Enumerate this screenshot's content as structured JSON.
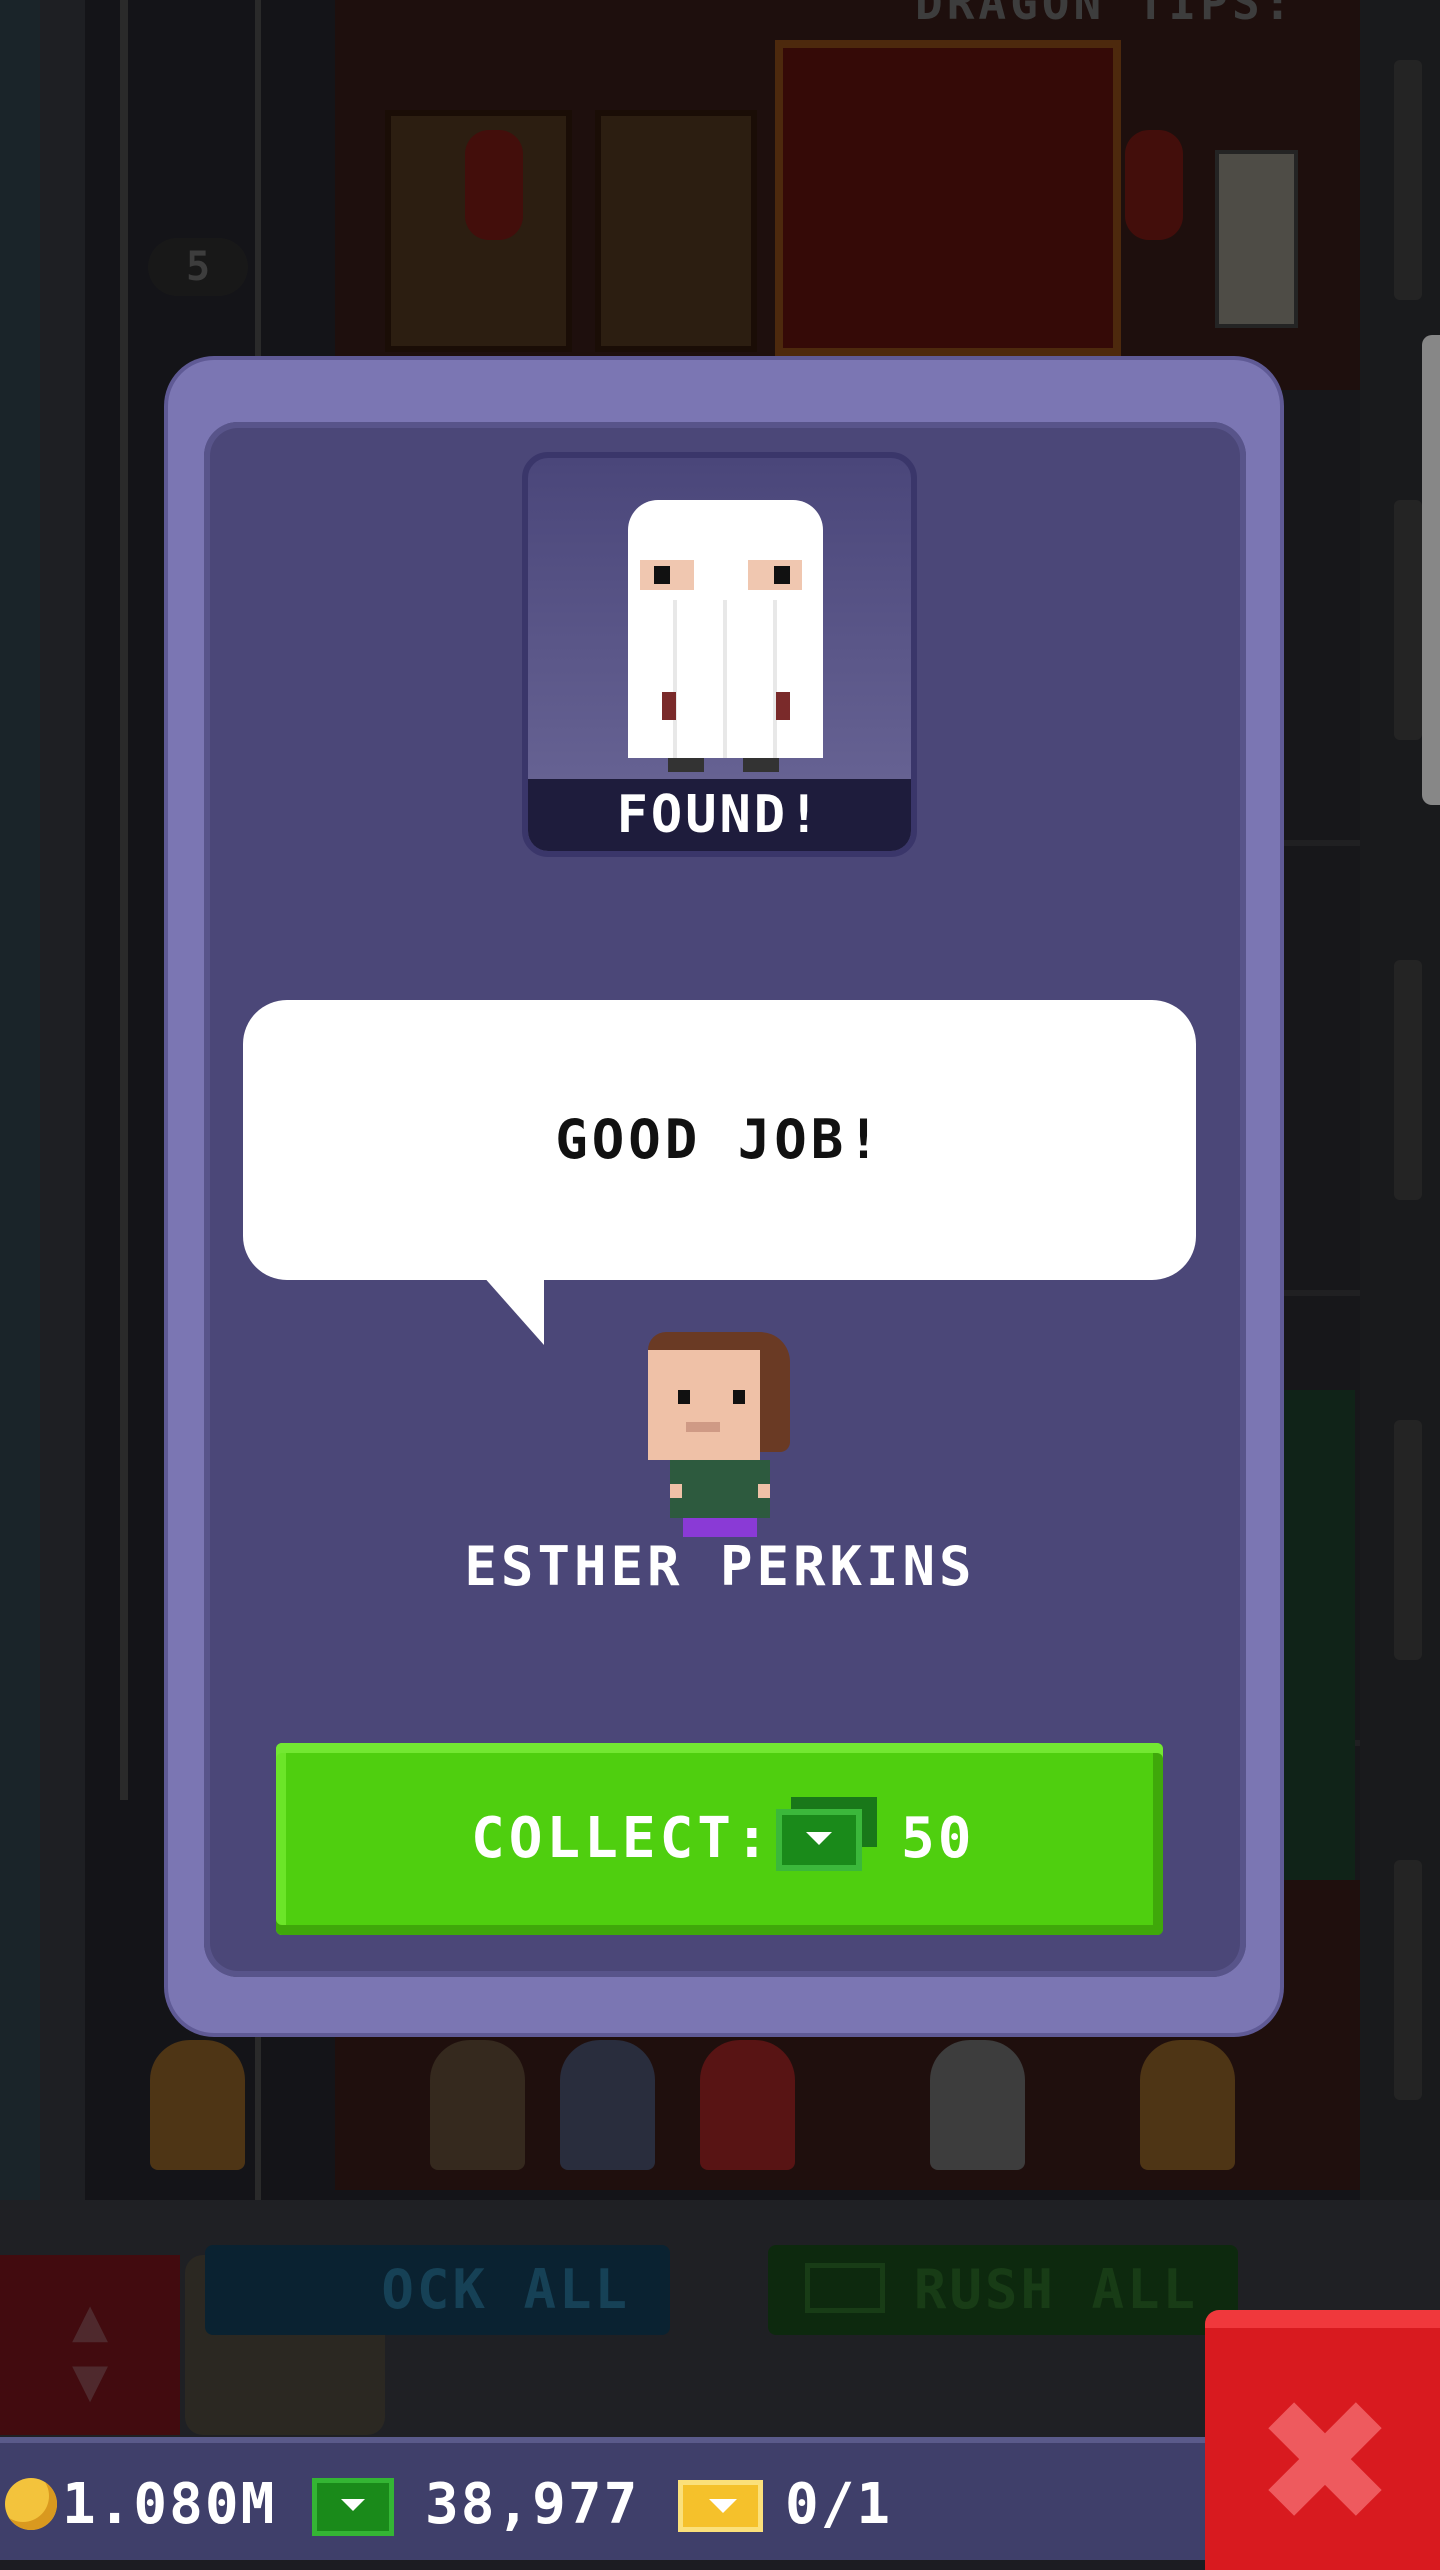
{
  "modal": {
    "status_label": "FOUND!",
    "speech_text": "GOOD JOB!",
    "bitizen_name": "ESTHER PERKINS",
    "collect_label": "COLLECT:",
    "collect_amount": "50"
  },
  "background": {
    "floor_number": "5",
    "room_title_fragment": "DRAGON TIPS:",
    "stock_all_fragment": "OCK ALL",
    "rush_all_label": "RUSH ALL"
  },
  "status_bar": {
    "coins": "1.080M",
    "bux": "38,977",
    "tickets": "0/1"
  },
  "icons": {
    "coin": "coin-icon",
    "bux": "bux-icon",
    "ticket": "golden-ticket-icon",
    "close": "close-icon"
  },
  "colors": {
    "modal_frame": "#7b76b3",
    "modal_inner": "#4b4778",
    "collect_green": "#4fcf0f",
    "close_red": "#d81a1f",
    "status_bar": "#3f3f6a"
  }
}
